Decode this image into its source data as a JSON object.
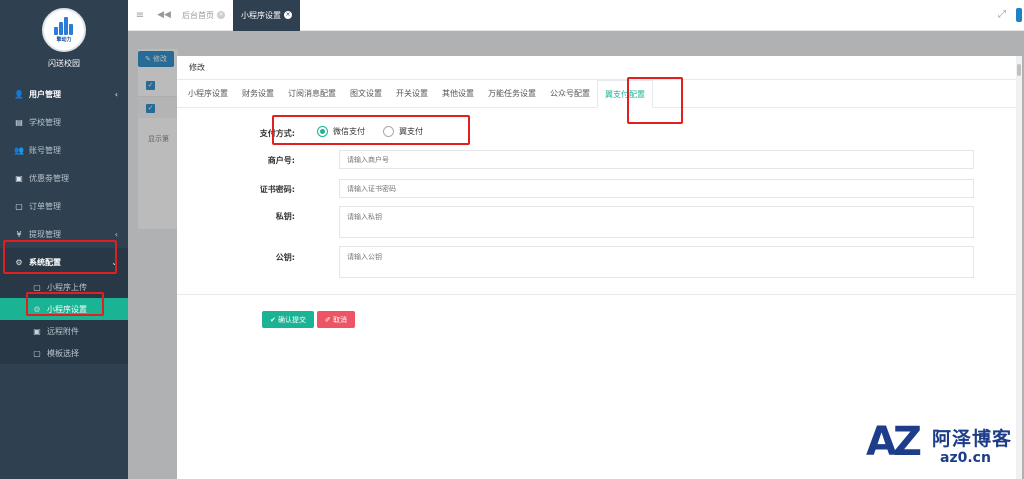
{
  "sidebar": {
    "logo_text": "擎动力",
    "app_name": "闪送校园",
    "items": [
      {
        "label": "用户管理",
        "icon": "user-icon",
        "glyph": "👤",
        "arrow": "‹"
      },
      {
        "label": "学校管理",
        "icon": "school-icon",
        "glyph": "▤"
      },
      {
        "label": "账号管理",
        "icon": "users-icon",
        "glyph": "👥"
      },
      {
        "label": "优惠劵管理",
        "icon": "coupon-icon",
        "glyph": "▣"
      },
      {
        "label": "订单管理",
        "icon": "order-icon",
        "glyph": "▢"
      },
      {
        "label": "提现管理",
        "icon": "yen-icon",
        "glyph": "¥",
        "arrow": "‹"
      },
      {
        "label": "系统配置",
        "icon": "gear-icon",
        "glyph": "⚙",
        "arrow": "⌄"
      }
    ],
    "sub_items": [
      {
        "label": "小程序上传",
        "icon": "upload-icon",
        "glyph": "▢"
      },
      {
        "label": "小程序设置",
        "icon": "gear-icon",
        "glyph": "⚙"
      },
      {
        "label": "远程附件",
        "icon": "attachment-icon",
        "glyph": "▣"
      },
      {
        "label": "模板选择",
        "icon": "template-icon",
        "glyph": "▢"
      }
    ]
  },
  "topbar": {
    "tabs": [
      {
        "label": "后台首页"
      },
      {
        "label": "小程序设置"
      }
    ],
    "active_tab": 1
  },
  "background": {
    "edit_label": "✎ 修改",
    "show_text": "显示第"
  },
  "modal": {
    "title": "修改",
    "tabs": [
      "小程序设置",
      "财务设置",
      "订阅消息配置",
      "图文设置",
      "开关设置",
      "其他设置",
      "万能任务设置",
      "公众号配置",
      "翼支付配置"
    ],
    "active_tab": 8,
    "form": {
      "pay_method_label": "支付方式:",
      "pay_options": [
        {
          "label": "微信支付",
          "checked": true
        },
        {
          "label": "翼支付",
          "checked": false
        }
      ],
      "merchant_label": "商户号:",
      "merchant_placeholder": "请输入商户号",
      "cert_label": "证书密码:",
      "cert_placeholder": "请输入证书密码",
      "private_key_label": "私钥:",
      "private_key_placeholder": "请输入私钥",
      "public_key_label": "公钥:",
      "public_key_placeholder": "请输入公钥"
    },
    "submit_label": "✔ 确认提交",
    "cancel_label": "✐ 取消"
  },
  "watermark": {
    "az": "AZ",
    "cn": "阿泽博客",
    "url": "az0.cn"
  },
  "colors": {
    "sidebar_bg": "#2f4050",
    "accent": "#1ab394",
    "primary": "#1c84c6",
    "danger": "#ed5565",
    "highlight": "#e02020"
  }
}
